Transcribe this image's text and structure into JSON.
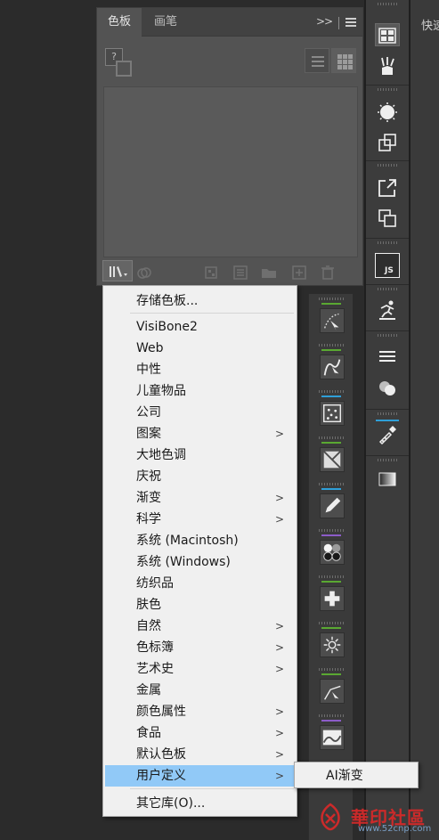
{
  "panel": {
    "tabs": [
      {
        "label": "色板",
        "active": true
      },
      {
        "label": "画笔",
        "active": false
      }
    ],
    "collapse_glyph": ">>",
    "swatch_indicator": "?"
  },
  "library_menu": {
    "items": [
      {
        "label": "存储色板...",
        "submenu": false
      },
      {
        "label": "VisiBone2",
        "submenu": false
      },
      {
        "label": "Web",
        "submenu": false
      },
      {
        "label": "中性",
        "submenu": false
      },
      {
        "label": "儿童物品",
        "submenu": false
      },
      {
        "label": "公司",
        "submenu": false
      },
      {
        "label": "图案",
        "submenu": true
      },
      {
        "label": "大地色调",
        "submenu": false
      },
      {
        "label": "庆祝",
        "submenu": false
      },
      {
        "label": "渐变",
        "submenu": true
      },
      {
        "label": "科学",
        "submenu": true
      },
      {
        "label": "系统 (Macintosh)",
        "submenu": false
      },
      {
        "label": "系统 (Windows)",
        "submenu": false
      },
      {
        "label": "纺织品",
        "submenu": false
      },
      {
        "label": "肤色",
        "submenu": false
      },
      {
        "label": "自然",
        "submenu": true
      },
      {
        "label": "色标簿",
        "submenu": true
      },
      {
        "label": "艺术史",
        "submenu": true
      },
      {
        "label": "金属",
        "submenu": false
      },
      {
        "label": "颜色属性",
        "submenu": true
      },
      {
        "label": "食品",
        "submenu": true
      },
      {
        "label": "默认色板",
        "submenu": true
      },
      {
        "label": "用户定义",
        "submenu": true,
        "highlighted": true
      },
      {
        "label": "其它库(O)...",
        "submenu": false
      }
    ],
    "submenu_arrow": ">"
  },
  "submenu": {
    "items": [
      {
        "label": "AI渐变"
      }
    ]
  },
  "far_right": {
    "label": "快速"
  },
  "watermark": {
    "text": "華印社區",
    "url": "www.52cnp.com"
  },
  "colors": {
    "panel_bg": "#535353",
    "menu_bg": "#f0f0f0",
    "menu_highlight": "#91c9f7",
    "accent_green": "#5aa832",
    "accent_blue": "#2f9fd8",
    "accent_purple": "#8c5cc8"
  }
}
